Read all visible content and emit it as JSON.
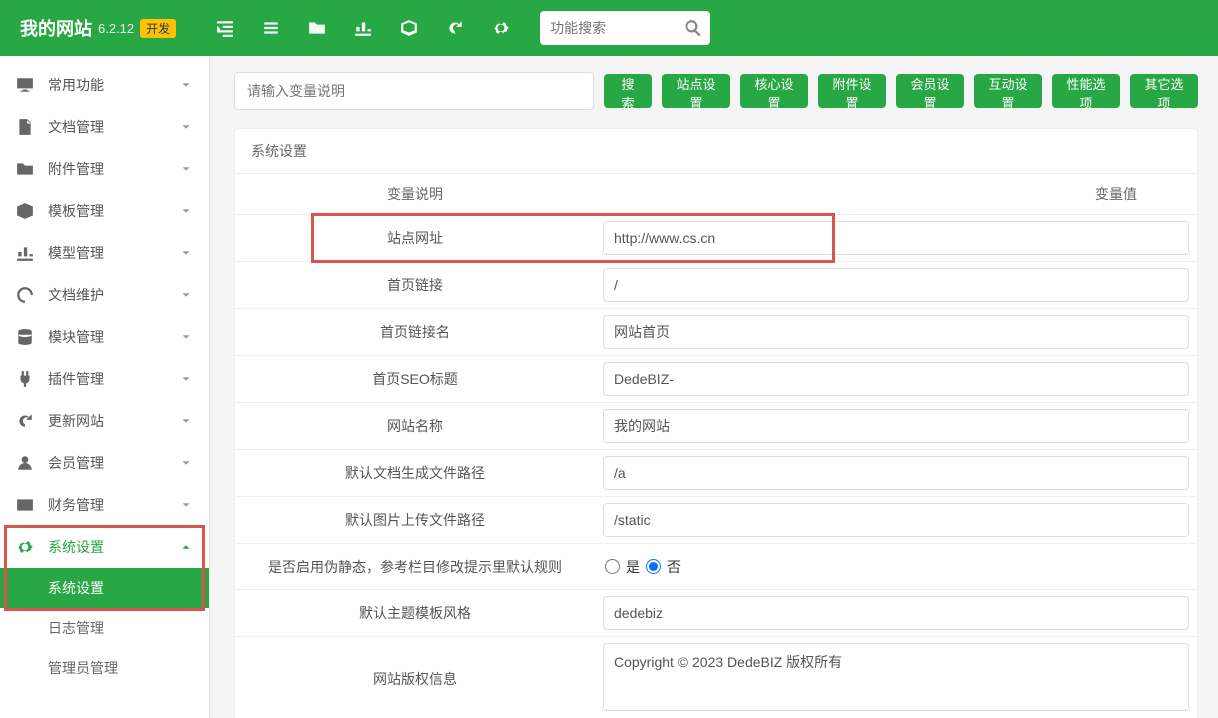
{
  "header": {
    "brand": "我的网站",
    "version": "6.2.12",
    "tag": "开发",
    "search_placeholder": "功能搜索"
  },
  "sidebar": {
    "items": [
      {
        "icon": "desktop",
        "label": "常用功能"
      },
      {
        "icon": "file",
        "label": "文档管理"
      },
      {
        "icon": "folder",
        "label": "附件管理"
      },
      {
        "icon": "cube",
        "label": "模板管理"
      },
      {
        "icon": "chart",
        "label": "模型管理"
      },
      {
        "icon": "spinner",
        "label": "文档维护"
      },
      {
        "icon": "db",
        "label": "模块管理"
      },
      {
        "icon": "plug",
        "label": "插件管理"
      },
      {
        "icon": "refresh",
        "label": "更新网站"
      },
      {
        "icon": "user",
        "label": "会员管理"
      },
      {
        "icon": "card",
        "label": "财务管理"
      }
    ],
    "expanded": {
      "icon": "gear",
      "label": "系统设置"
    },
    "subs": [
      "系统设置",
      "日志管理",
      "管理员管理"
    ]
  },
  "content": {
    "search_placeholder": "请输入变量说明",
    "buttons": [
      "搜索",
      "站点设置",
      "核心设置",
      "附件设置",
      "会员设置",
      "互动设置",
      "性能选项",
      "其它选项"
    ],
    "panel_title": "系统设置",
    "cols": {
      "label": "变量说明",
      "value": "变量值"
    },
    "rows": [
      {
        "label": "站点网址",
        "type": "text",
        "value": "http://www.cs.cn",
        "highlight": true
      },
      {
        "label": "首页链接",
        "type": "text",
        "value": "/"
      },
      {
        "label": "首页链接名",
        "type": "text",
        "value": "网站首页"
      },
      {
        "label": "首页SEO标题",
        "type": "text",
        "value": "DedeBIZ-"
      },
      {
        "label": "网站名称",
        "type": "text",
        "value": "我的网站"
      },
      {
        "label": "默认文档生成文件路径",
        "type": "text",
        "value": "/a"
      },
      {
        "label": "默认图片上传文件路径",
        "type": "text",
        "value": "/static"
      },
      {
        "label": "是否启用伪静态，参考栏目修改提示里默认规则",
        "type": "radio",
        "yes": "是",
        "no": "否",
        "selected": "no"
      },
      {
        "label": "默认主题模板风格",
        "type": "text",
        "value": "dedebiz"
      },
      {
        "label": "网站版权信息",
        "type": "textarea",
        "value": "Copyright © 2023 DedeBIZ 版权所有"
      }
    ]
  }
}
